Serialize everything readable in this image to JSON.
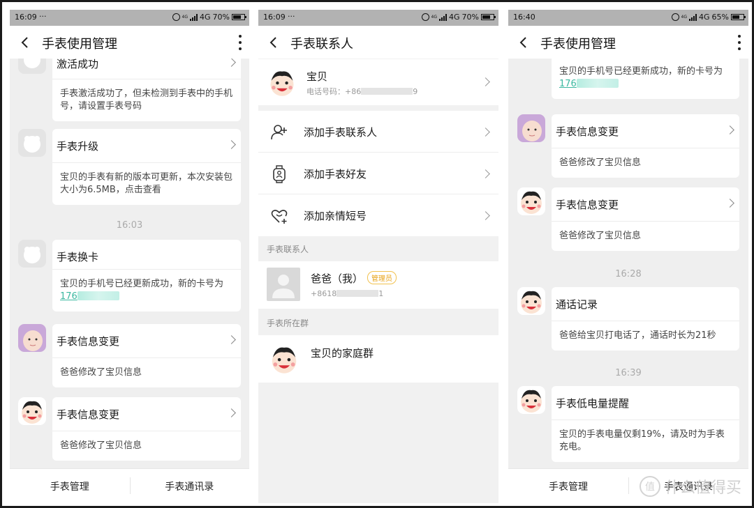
{
  "panels": [
    {
      "status": {
        "time": "16:09",
        "dots": "···",
        "net_small": "4G",
        "net": "4G",
        "battery": "70%",
        "battery_level": 0.7
      },
      "nav": {
        "title": "手表使用管理"
      },
      "cards": [
        {
          "avatar": "default",
          "title": "激活成功",
          "body": "手表激活成功了，但未检测到手表中的手机号，请设置手表号码"
        },
        {
          "avatar": "default",
          "title": "手表升级",
          "body": "宝贝的手表有新的版本可更新，本次安装包大小为6.5MB，点击查看"
        },
        {
          "avatar": "default",
          "title": "手表换卡",
          "body": "宝贝的手机号已经更新成功，新的卡号为",
          "link": "176"
        },
        {
          "avatar": "baby",
          "title": "手表信息变更",
          "body": "爸爸修改了宝贝信息"
        },
        {
          "avatar": "cartoon",
          "title": "手表信息变更",
          "body": "爸爸修改了宝贝信息"
        }
      ],
      "timestamps": [
        "16:03"
      ],
      "tabs": [
        "手表管理",
        "手表通讯录"
      ]
    },
    {
      "status": {
        "time": "16:09",
        "dots": "···",
        "net_small": "4G",
        "net": "4G",
        "battery": "70%",
        "battery_level": 0.7
      },
      "nav": {
        "title": "手表联系人"
      },
      "top_contact": {
        "name": "宝贝",
        "phone": "电话号码：+86",
        "phone_tail": "9"
      },
      "actions": [
        "添加手表联系人",
        "添加手表好友",
        "添加亲情短号"
      ],
      "section_contacts": "手表联系人",
      "contact": {
        "name": "爸爸（我）",
        "badge": "管理员",
        "phone": "+8618",
        "phone_tail": "1"
      },
      "section_groups": "手表所在群",
      "group": {
        "name": "宝贝的家庭群"
      }
    },
    {
      "status": {
        "time": "16:40",
        "net_small": "4G",
        "net": "4G",
        "battery": "65%",
        "battery_level": 0.65
      },
      "nav": {
        "title": "手表使用管理"
      },
      "cards": [
        {
          "avatar": "none",
          "title": "",
          "body": "宝贝的手机号已经更新成功，新的卡号为",
          "link": "176"
        },
        {
          "avatar": "baby",
          "title": "手表信息变更",
          "body": "爸爸修改了宝贝信息"
        },
        {
          "avatar": "cartoon",
          "title": "手表信息变更",
          "body": "爸爸修改了宝贝信息"
        },
        {
          "avatar": "cartoon",
          "title": "通话记录",
          "body": "爸爸给宝贝打电话了，通话时长为21秒"
        },
        {
          "avatar": "cartoon",
          "title": "手表低电量提醒",
          "body": "宝贝的手表电量仅剩19%，请及时为手表充电。"
        }
      ],
      "timestamps": [
        "16:28",
        "16:39"
      ],
      "tabs": [
        "手表管理",
        "手表通讯录"
      ]
    }
  ],
  "watermark": {
    "icon": "值",
    "text": "什么值得买"
  },
  "colors": {
    "link": "#3bb8a0",
    "badge": "#e8a317",
    "status_bar": "#b2b2b2"
  }
}
